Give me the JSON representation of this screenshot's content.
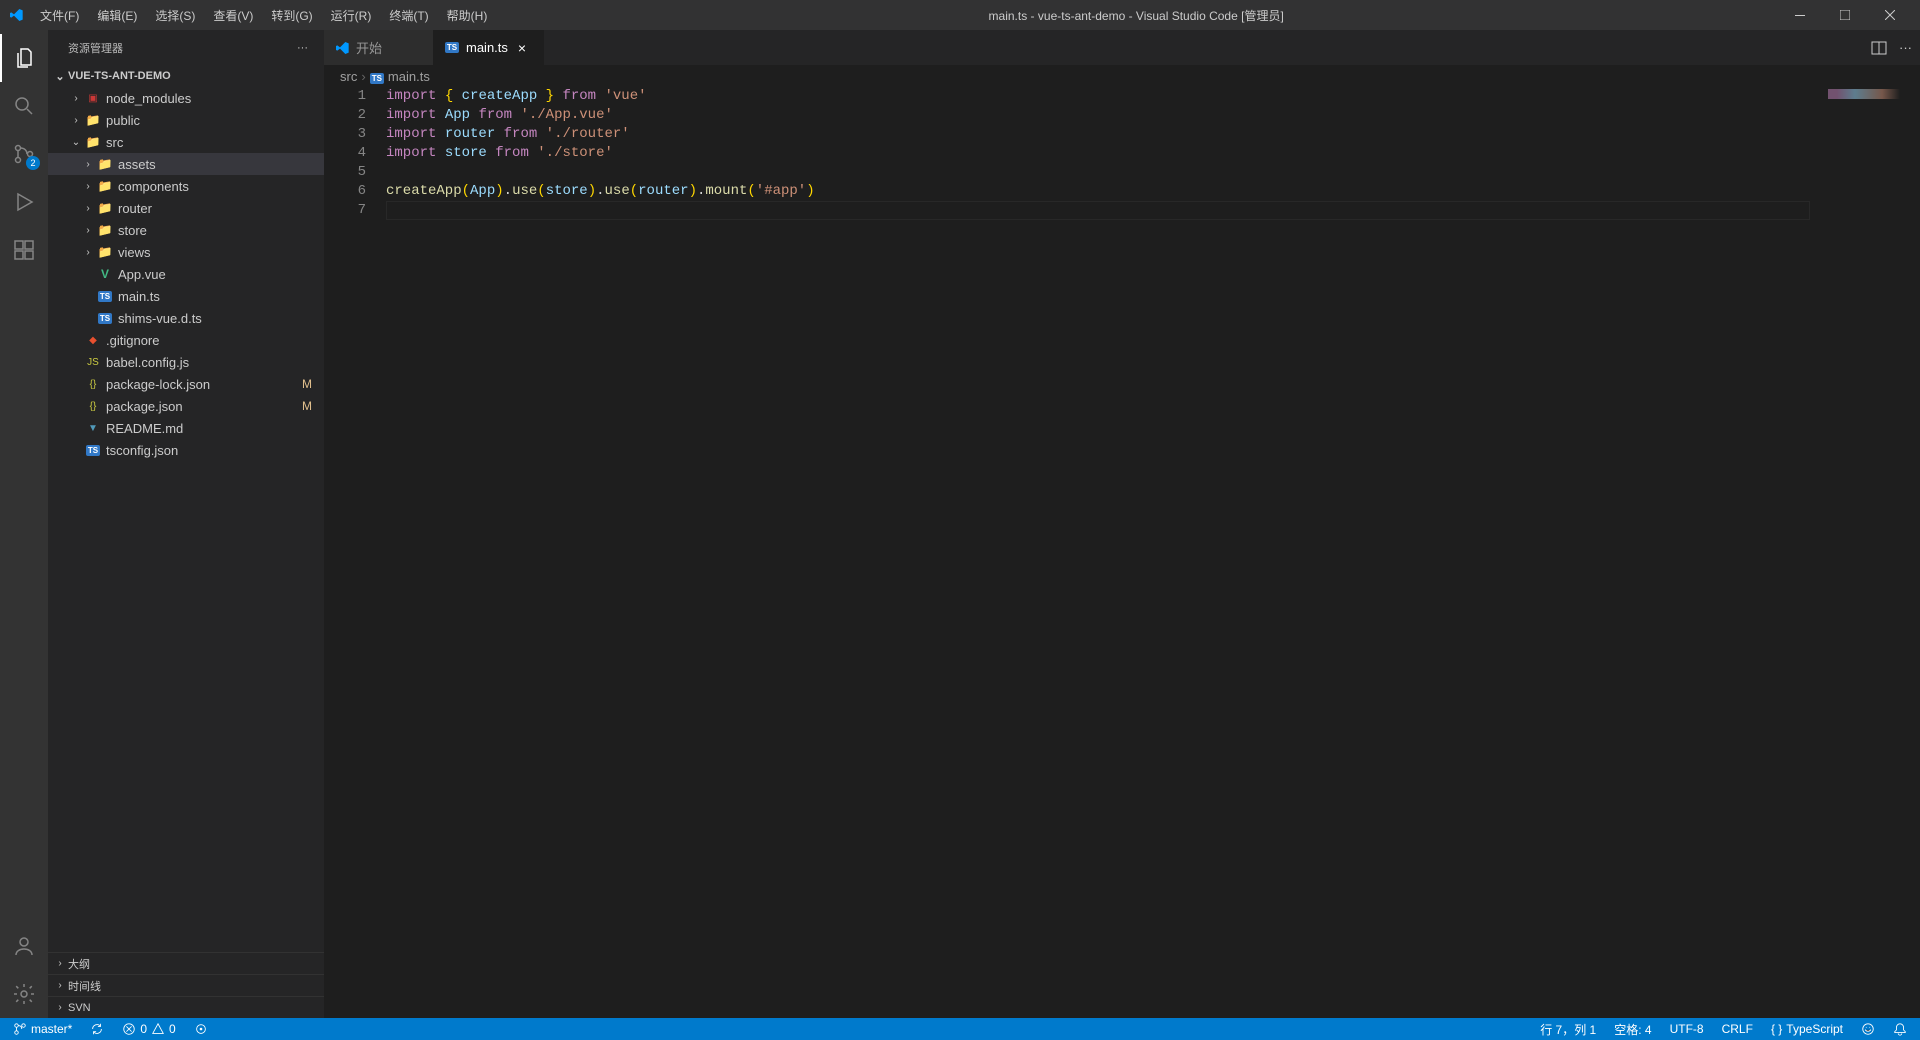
{
  "titlebar": {
    "menu": [
      "文件(F)",
      "编辑(E)",
      "选择(S)",
      "查看(V)",
      "转到(G)",
      "运行(R)",
      "终端(T)",
      "帮助(H)"
    ],
    "title": "main.ts - vue-ts-ant-demo - Visual Studio Code [管理员]"
  },
  "activity": {
    "scm_badge": "2"
  },
  "sidebar": {
    "title": "资源管理器",
    "project": "VUE-TS-ANT-DEMO",
    "tree": [
      {
        "type": "folder",
        "name": "node_modules",
        "depth": 1,
        "expanded": false,
        "icon": "npm"
      },
      {
        "type": "folder",
        "name": "public",
        "depth": 1,
        "expanded": false,
        "icon": "folder"
      },
      {
        "type": "folder",
        "name": "src",
        "depth": 1,
        "expanded": true,
        "icon": "folder"
      },
      {
        "type": "folder",
        "name": "assets",
        "depth": 2,
        "expanded": false,
        "icon": "folder",
        "selected": true
      },
      {
        "type": "folder",
        "name": "components",
        "depth": 2,
        "expanded": false,
        "icon": "folder"
      },
      {
        "type": "folder",
        "name": "router",
        "depth": 2,
        "expanded": false,
        "icon": "folder"
      },
      {
        "type": "folder",
        "name": "store",
        "depth": 2,
        "expanded": false,
        "icon": "folder"
      },
      {
        "type": "folder",
        "name": "views",
        "depth": 2,
        "expanded": false,
        "icon": "folder"
      },
      {
        "type": "file",
        "name": "App.vue",
        "depth": 2,
        "icon": "vue"
      },
      {
        "type": "file",
        "name": "main.ts",
        "depth": 2,
        "icon": "ts"
      },
      {
        "type": "file",
        "name": "shims-vue.d.ts",
        "depth": 2,
        "icon": "ts"
      },
      {
        "type": "file",
        "name": ".gitignore",
        "depth": 1,
        "icon": "git"
      },
      {
        "type": "file",
        "name": "babel.config.js",
        "depth": 1,
        "icon": "js"
      },
      {
        "type": "file",
        "name": "package-lock.json",
        "depth": 1,
        "icon": "json",
        "git": "M"
      },
      {
        "type": "file",
        "name": "package.json",
        "depth": 1,
        "icon": "json",
        "git": "M"
      },
      {
        "type": "file",
        "name": "README.md",
        "depth": 1,
        "icon": "md"
      },
      {
        "type": "file",
        "name": "tsconfig.json",
        "depth": 1,
        "icon": "ts"
      }
    ],
    "panels": [
      "大纲",
      "时间线",
      "SVN"
    ]
  },
  "tabs": [
    {
      "label": "开始",
      "icon": "vscode",
      "active": false
    },
    {
      "label": "main.ts",
      "icon": "ts",
      "active": true
    }
  ],
  "breadcrumb": [
    "src",
    "main.ts"
  ],
  "code": {
    "lines": [
      [
        {
          "t": "import",
          "c": "keyword"
        },
        {
          "t": " ",
          "c": "punct"
        },
        {
          "t": "{",
          "c": "brace"
        },
        {
          "t": " createApp ",
          "c": "var"
        },
        {
          "t": "}",
          "c": "brace"
        },
        {
          "t": " ",
          "c": "punct"
        },
        {
          "t": "from",
          "c": "keyword"
        },
        {
          "t": " ",
          "c": "punct"
        },
        {
          "t": "'vue'",
          "c": "string"
        }
      ],
      [
        {
          "t": "import",
          "c": "keyword"
        },
        {
          "t": " ",
          "c": "punct"
        },
        {
          "t": "App",
          "c": "var"
        },
        {
          "t": " ",
          "c": "punct"
        },
        {
          "t": "from",
          "c": "keyword"
        },
        {
          "t": " ",
          "c": "punct"
        },
        {
          "t": "'./App.vue'",
          "c": "string"
        }
      ],
      [
        {
          "t": "import",
          "c": "keyword"
        },
        {
          "t": " ",
          "c": "punct"
        },
        {
          "t": "router",
          "c": "var"
        },
        {
          "t": " ",
          "c": "punct"
        },
        {
          "t": "from",
          "c": "keyword"
        },
        {
          "t": " ",
          "c": "punct"
        },
        {
          "t": "'./router'",
          "c": "string"
        }
      ],
      [
        {
          "t": "import",
          "c": "keyword"
        },
        {
          "t": " ",
          "c": "punct"
        },
        {
          "t": "store",
          "c": "var"
        },
        {
          "t": " ",
          "c": "punct"
        },
        {
          "t": "from",
          "c": "keyword"
        },
        {
          "t": " ",
          "c": "punct"
        },
        {
          "t": "'./store'",
          "c": "string"
        }
      ],
      [],
      [
        {
          "t": "createApp",
          "c": "func"
        },
        {
          "t": "(",
          "c": "brace"
        },
        {
          "t": "App",
          "c": "var"
        },
        {
          "t": ")",
          "c": "brace"
        },
        {
          "t": ".",
          "c": "punct"
        },
        {
          "t": "use",
          "c": "func"
        },
        {
          "t": "(",
          "c": "brace"
        },
        {
          "t": "store",
          "c": "var"
        },
        {
          "t": ")",
          "c": "brace"
        },
        {
          "t": ".",
          "c": "punct"
        },
        {
          "t": "use",
          "c": "func"
        },
        {
          "t": "(",
          "c": "brace"
        },
        {
          "t": "router",
          "c": "var"
        },
        {
          "t": ")",
          "c": "brace"
        },
        {
          "t": ".",
          "c": "punct"
        },
        {
          "t": "mount",
          "c": "func"
        },
        {
          "t": "(",
          "c": "brace"
        },
        {
          "t": "'#app'",
          "c": "string"
        },
        {
          "t": ")",
          "c": "brace"
        }
      ],
      []
    ],
    "cursor_line": 7
  },
  "statusbar": {
    "branch": "master*",
    "errors": "0",
    "warnings": "0",
    "position": "行 7，列 1",
    "spaces": "空格: 4",
    "encoding": "UTF-8",
    "eol": "CRLF",
    "lang": "TypeScript"
  }
}
